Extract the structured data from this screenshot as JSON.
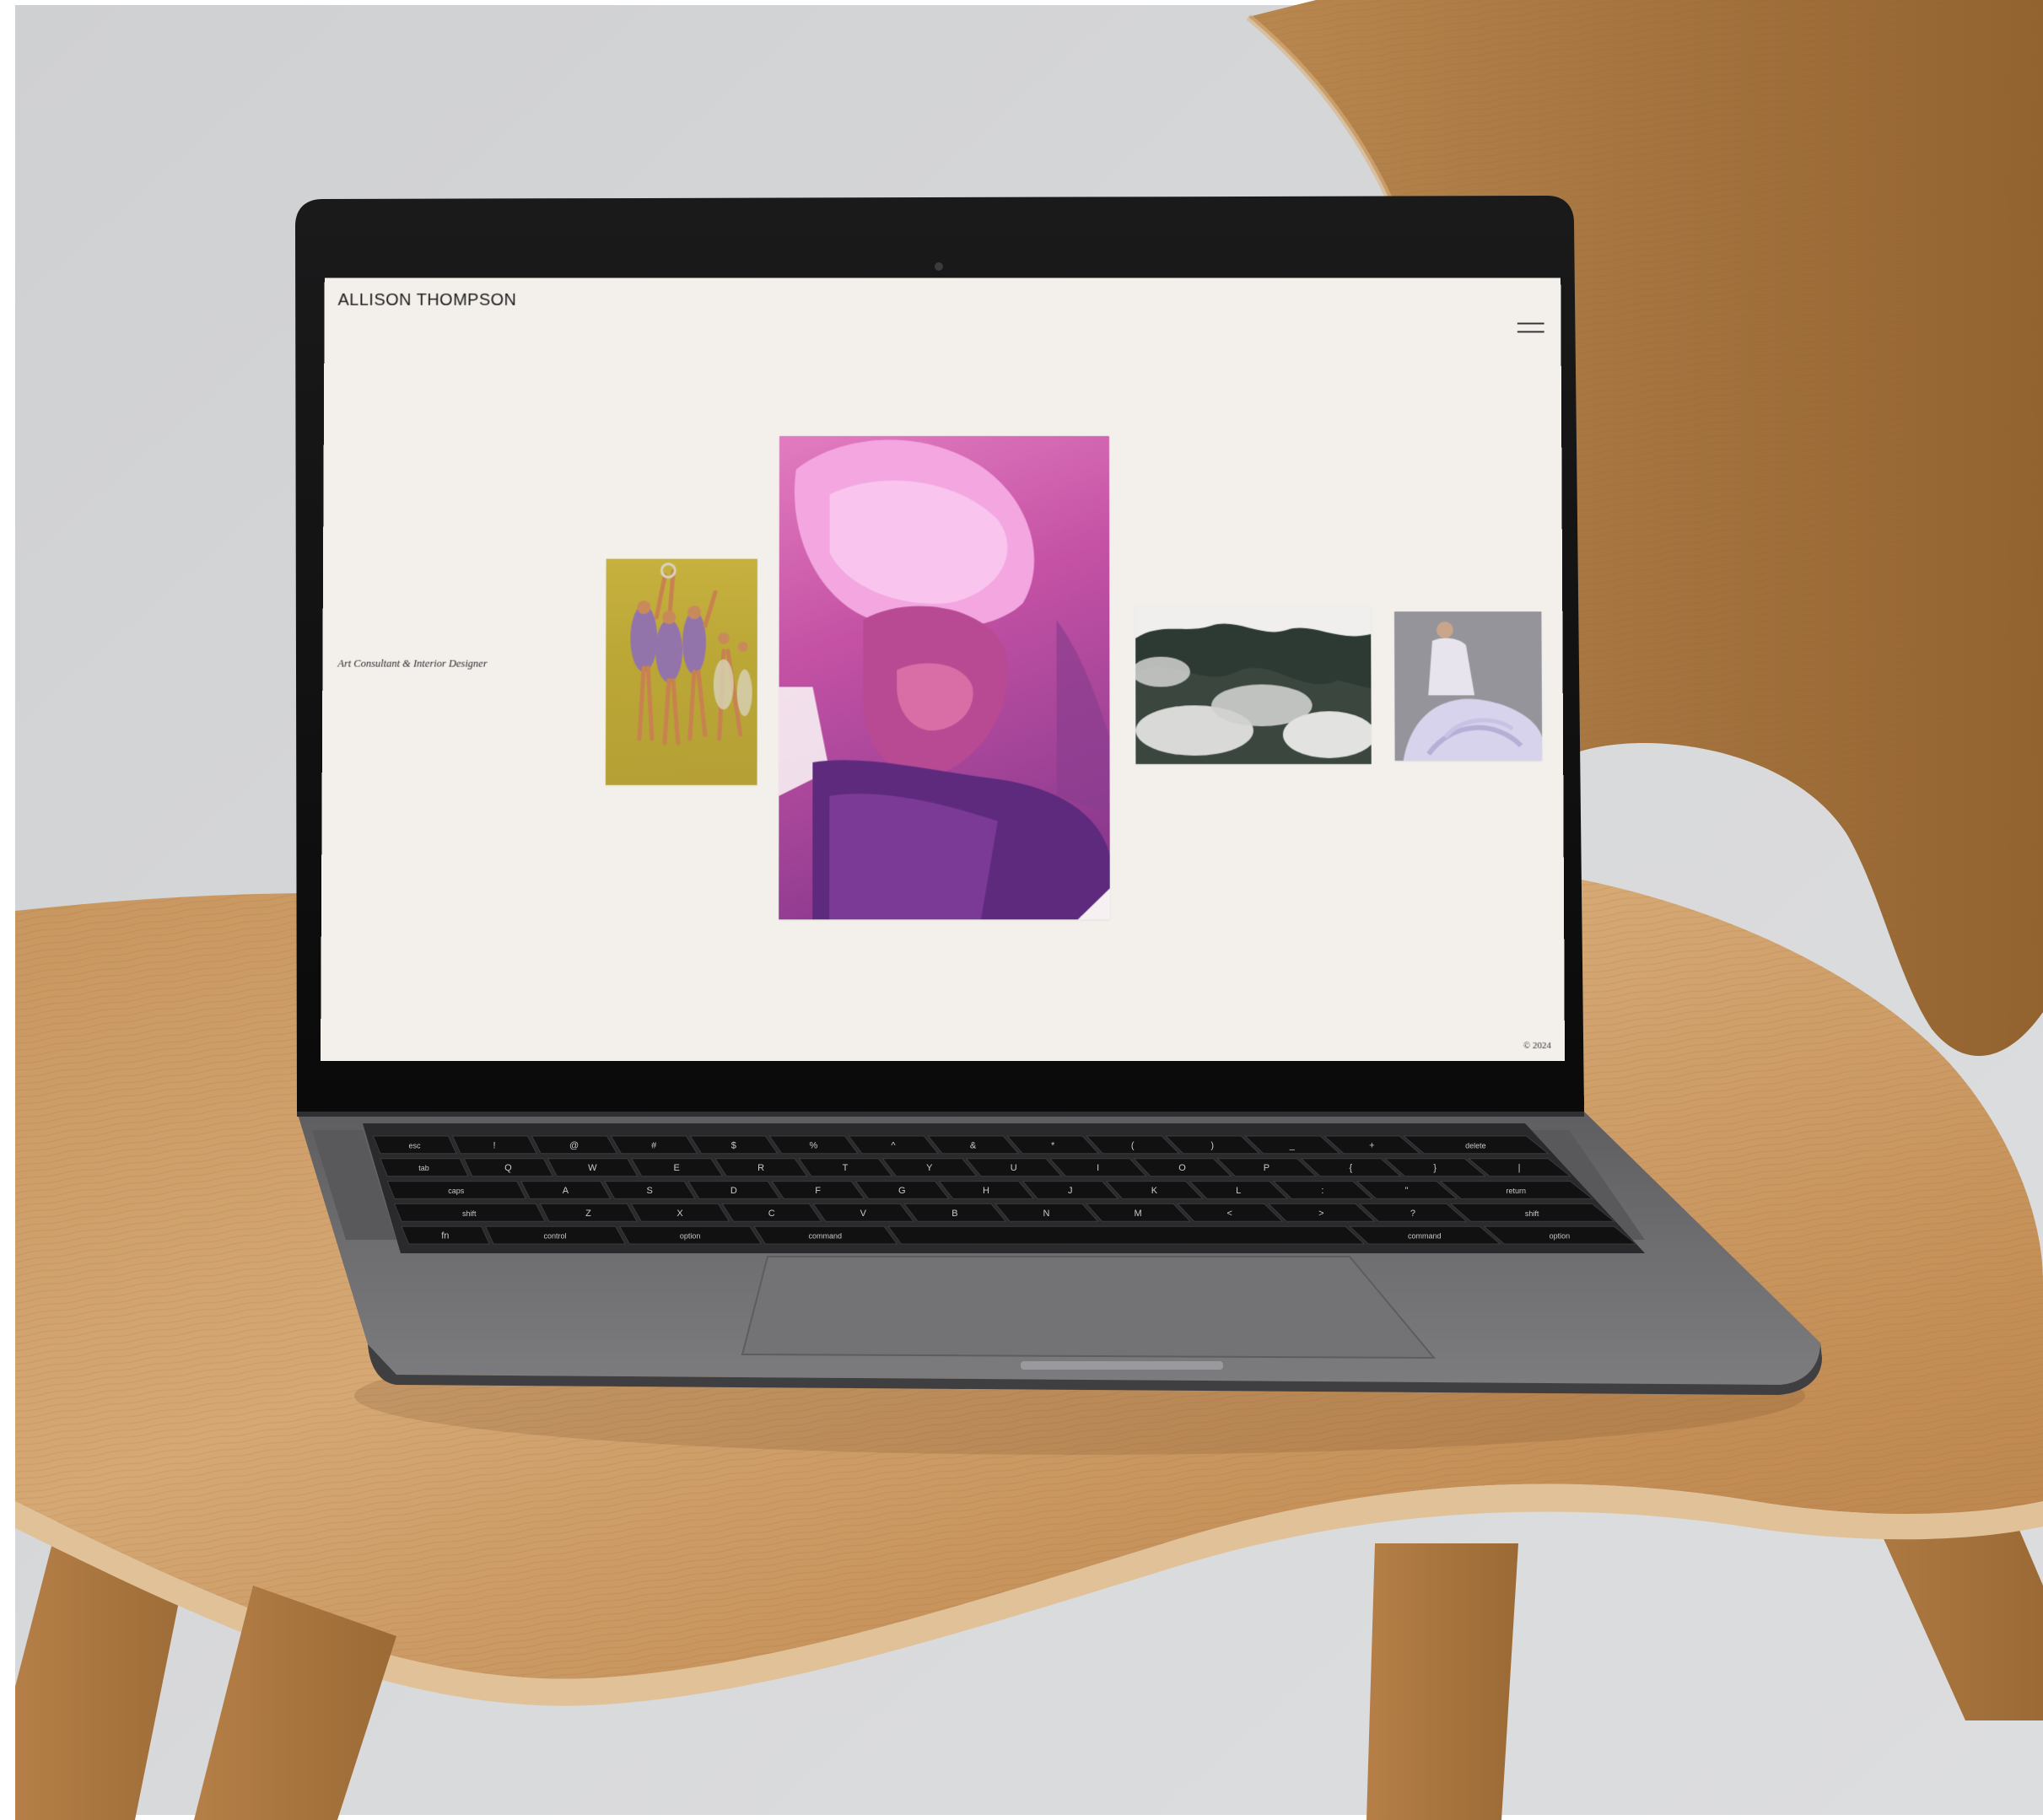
{
  "site": {
    "title": "ALLISON THOMPSON",
    "tagline": "Art Consultant & Interior Designer",
    "copyright": "© 2024"
  },
  "icons": {
    "menu": "hamburger-icon"
  },
  "keyboard": {
    "row1": [
      "esc",
      "!",
      "@",
      "#",
      "$",
      "%",
      "^",
      "&",
      "*",
      "(",
      ")",
      "_",
      "+",
      "delete"
    ],
    "row2": [
      "tab",
      "Q",
      "W",
      "E",
      "R",
      "T",
      "Y",
      "U",
      "I",
      "O",
      "P",
      "{",
      "}",
      "|"
    ],
    "row3": [
      "caps",
      "A",
      "S",
      "D",
      "F",
      "G",
      "H",
      "J",
      "K",
      "L",
      ":",
      "\"",
      "return"
    ],
    "row4": [
      "shift",
      "Z",
      "X",
      "C",
      "V",
      "B",
      "N",
      "M",
      "<",
      ">",
      "?",
      "shift"
    ],
    "row5": [
      "fn",
      "control",
      "option",
      "command",
      "",
      "command",
      "option"
    ]
  },
  "colors": {
    "site_background": "#f3f0ec",
    "wood": "#c8945e",
    "aluminium": "#6d6d70",
    "backdrop": "#d5d6d8"
  }
}
